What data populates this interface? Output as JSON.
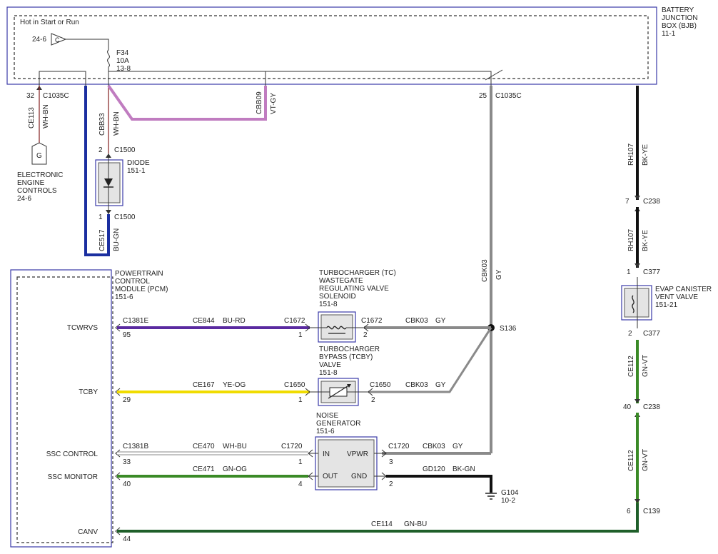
{
  "bjb": {
    "title_1": "BATTERY",
    "title_2": "JUNCTION",
    "title_3": "BOX (BJB)",
    "ref": "11-1",
    "hot": "Hot in Start or Run"
  },
  "fuse_ref": "24-6",
  "fuse_pin": "C",
  "fuse": {
    "name": "F34",
    "rating": "10A",
    "ref": "13-8"
  },
  "eec": {
    "pin": "32",
    "conn": "C1035C",
    "circuit": "CE113",
    "color": "WH-BN",
    "pin_letter": "G",
    "line1": "ELECTRONIC",
    "line2": "ENGINE",
    "line3": "CONTROLS",
    "ref": "24-6"
  },
  "diode": {
    "label": "DIODE",
    "ref": "151-1",
    "top_pin": "2",
    "top_conn": "C1500",
    "bot_pin": "1",
    "bot_conn": "C1500",
    "in_circuit": "CBB33",
    "in_color": "WH-BN",
    "out_circuit": "CE517",
    "out_color": "BU-GN"
  },
  "cbb09": {
    "circuit": "CBB09",
    "color": "VT-GY"
  },
  "c1035c_25": {
    "pin": "25",
    "conn": "C1035C",
    "circuit": "CBK03",
    "color": "GY"
  },
  "rh107": {
    "circuit": "RH107",
    "color": "BK-YE",
    "c238_pin": "7",
    "c238": "C238",
    "c377_pin": "1",
    "c377": "C377"
  },
  "evap": {
    "line1": "EVAP CANISTER",
    "line2": "VENT VALVE",
    "ref": "151-21",
    "out_pin": "2",
    "out_conn": "C377"
  },
  "ce112": {
    "circuit": "CE112",
    "color": "GN-VT",
    "c238_pin": "40",
    "c238": "C238",
    "c139_pin": "6",
    "c139": "C139"
  },
  "pcm": {
    "line1": "POWERTRAIN",
    "line2": "CONTROL",
    "line3": "MODULE (PCM)",
    "ref": "151-6"
  },
  "pins": {
    "tcwrvs": "TCWRVS",
    "tcby": "TCBY",
    "ssc_control": "SSC CONTROL",
    "ssc_monitor": "SSC MONITOR",
    "canv": "CANV"
  },
  "tcwrvs": {
    "pcm_conn": "C1381E",
    "pcm_pin": "95",
    "circuit": "CE844",
    "color": "BU-RD",
    "dev_conn": "C1672",
    "dev_pin": "1",
    "out_conn": "C1672",
    "out_pin": "2",
    "out_circuit": "CBK03",
    "out_color": "GY"
  },
  "wastegate": {
    "line1": "TURBOCHARGER (TC)",
    "line2": "WASTEGATE",
    "line3": "REGULATING VALVE",
    "line4": "SOLENOID",
    "ref": "151-8"
  },
  "splice": "S136",
  "tcby": {
    "pcm_pin": "29",
    "circuit": "CE167",
    "color": "YE-OG",
    "dev_conn": "C1650",
    "dev_pin": "1",
    "out_conn": "C1650",
    "out_pin": "2",
    "out_circuit": "CBK03",
    "out_color": "GY"
  },
  "bypass": {
    "line1": "TURBOCHARGER",
    "line2": "BYPASS (TCBY)",
    "line3": "VALVE",
    "ref": "151-8"
  },
  "noise": {
    "line1": "NOISE",
    "line2": "GENERATOR",
    "ref": "151-6",
    "in": "IN",
    "out": "OUT",
    "vpwr": "VPWR",
    "gnd": "GND"
  },
  "ssc_control": {
    "pcm_conn": "C1381B",
    "pcm_pin": "33",
    "circuit": "CE470",
    "color": "WH-BU",
    "dev_conn": "C1720",
    "dev_pin": "1",
    "out_conn": "C1720",
    "out_pin": "3",
    "out_circuit": "CBK03",
    "out_color": "GY"
  },
  "ssc_monitor": {
    "pcm_pin": "40",
    "circuit": "CE471",
    "color": "GN-OG",
    "dev_pin": "4",
    "gnd_pin": "2",
    "gnd_circuit": "GD120",
    "gnd_color": "BK-GN"
  },
  "ground": {
    "name": "G104",
    "ref": "10-2"
  },
  "canv": {
    "pcm_pin": "44",
    "circuit": "CE114",
    "color": "GN-BU"
  },
  "colors": {
    "blue": "#1b2fa0",
    "violet_gray": "#c07cc0",
    "gray": "#8a8a8a",
    "purple": "#5a2aa0",
    "yellow": "#f0dc00",
    "green": "#3a8a26",
    "dark_green": "#1f5f2a",
    "black": "#111111"
  }
}
